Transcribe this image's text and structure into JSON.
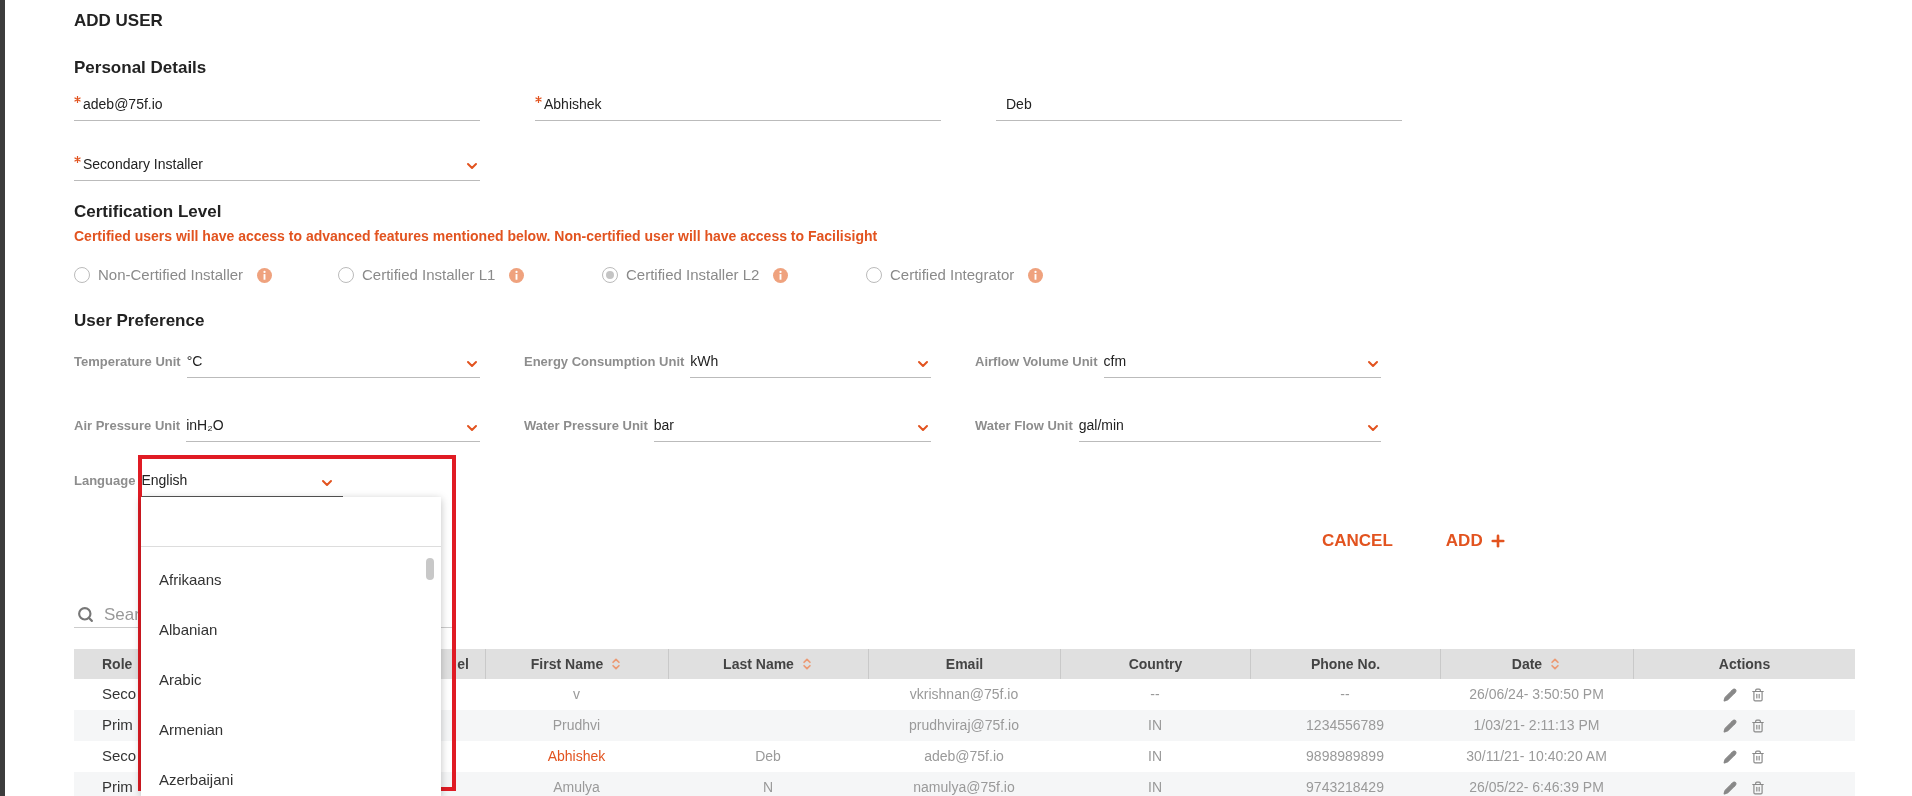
{
  "title": "ADD USER",
  "personal_details": {
    "heading": "Personal Details",
    "fields": [
      {
        "kind": "text",
        "value": "adeb@75f.io",
        "required": true
      },
      {
        "kind": "text",
        "value": "Abhishek",
        "required": true
      },
      {
        "kind": "text",
        "value": "Deb",
        "required": false
      },
      {
        "kind": "select",
        "value": "Secondary Installer",
        "required": true
      }
    ]
  },
  "certification": {
    "heading": "Certification Level",
    "note": "Certified users will have access to advanced features mentioned below. Non-certified user will have access to Facilisight",
    "options": [
      {
        "label": "Non-Certified Installer",
        "selected": false,
        "disabled": true
      },
      {
        "label": "Certified Installer L1",
        "selected": false,
        "disabled": true
      },
      {
        "label": "Certified Installer L2",
        "selected": true,
        "disabled": true
      },
      {
        "label": "Certified Integrator",
        "selected": false,
        "disabled": true
      }
    ]
  },
  "user_preference": {
    "heading": "User Preference",
    "fields": [
      {
        "label": "Temperature Unit",
        "value": "°C"
      },
      {
        "label": "Energy Consumption Unit",
        "value": "kWh"
      },
      {
        "label": "Airflow Volume Unit",
        "value": "cfm"
      },
      {
        "label": "Air Pressure Unit",
        "value": "inH₂O"
      },
      {
        "label": "Water Pressure Unit",
        "value": "bar"
      },
      {
        "label": "Water Flow Unit",
        "value": "gal/min"
      }
    ]
  },
  "language": {
    "label": "Language",
    "value": "English",
    "expanded": true,
    "options": [
      "Afrikaans",
      "Albanian",
      "Arabic",
      "Armenian",
      "Azerbaijani"
    ]
  },
  "actions": [
    {
      "kind": "text",
      "label": "CANCEL"
    },
    {
      "kind": "add",
      "label": "ADD"
    }
  ],
  "search": {
    "placeholder": "Sear"
  },
  "table": {
    "columns": [
      {
        "label": "Role",
        "sortable": false
      },
      {
        "label": "el",
        "sortable": false
      },
      {
        "label": "First Name",
        "sortable": true
      },
      {
        "label": "Last Name",
        "sortable": true
      },
      {
        "label": "Email",
        "sortable": false
      },
      {
        "label": "Country",
        "sortable": false
      },
      {
        "label": "Phone No.",
        "sortable": false
      },
      {
        "label": "Date",
        "sortable": true
      },
      {
        "label": "Actions",
        "sortable": false
      }
    ],
    "rows": [
      {
        "current": false,
        "cells": [
          "Seco",
          null,
          "v",
          null,
          "vkrishnan@75f.io",
          "--",
          "--",
          "26/06/24- 3:50:50 PM",
          null
        ]
      },
      {
        "current": false,
        "cells": [
          "Prim",
          null,
          "Prudhvi",
          null,
          "prudhviraj@75f.io",
          "IN",
          "1234556789",
          "1/03/21- 2:11:13 PM",
          null
        ]
      },
      {
        "current": true,
        "cells": [
          "Seco",
          null,
          "Abhishek",
          "Deb",
          "adeb@75f.io",
          "IN",
          "9898989899",
          "30/11/21- 10:40:20 AM",
          null
        ]
      },
      {
        "current": false,
        "cells": [
          "Prim",
          null,
          "Amulya",
          "N",
          "namulya@75f.io",
          "IN",
          "9743218429",
          "26/05/22- 6:46:39 PM",
          null
        ]
      }
    ]
  }
}
